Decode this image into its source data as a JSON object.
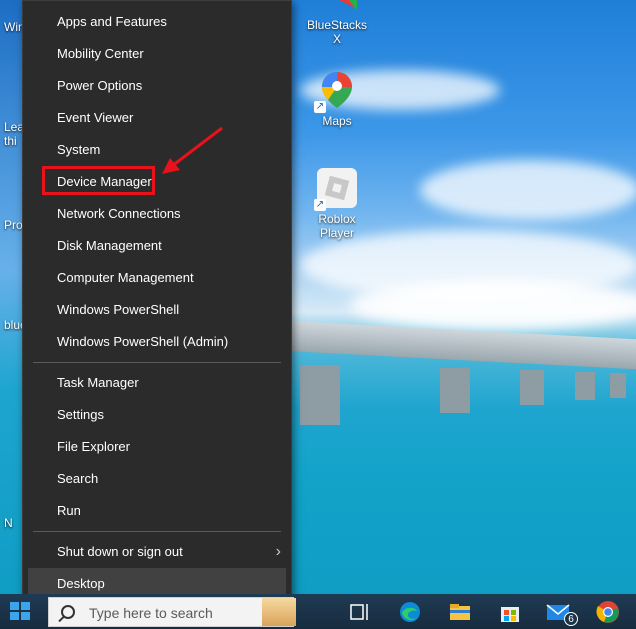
{
  "desktop": {
    "icons": [
      {
        "label": "BlueStacks X"
      },
      {
        "label": "Maps"
      },
      {
        "label": "Roblox Player"
      }
    ],
    "clipped_labels": [
      "Win",
      "Lea",
      "thi",
      "Pro",
      "blue",
      "N"
    ]
  },
  "menu": {
    "items_group1": [
      {
        "label": "Apps and Features"
      },
      {
        "label": "Mobility Center"
      },
      {
        "label": "Power Options"
      },
      {
        "label": "Event Viewer"
      },
      {
        "label": "System"
      },
      {
        "label": "Device Manager"
      },
      {
        "label": "Network Connections"
      },
      {
        "label": "Disk Management"
      },
      {
        "label": "Computer Management"
      },
      {
        "label": "Windows PowerShell"
      },
      {
        "label": "Windows PowerShell (Admin)"
      }
    ],
    "items_group2": [
      {
        "label": "Task Manager"
      },
      {
        "label": "Settings"
      },
      {
        "label": "File Explorer"
      },
      {
        "label": "Search"
      },
      {
        "label": "Run"
      }
    ],
    "items_group3": [
      {
        "label": "Shut down or sign out"
      },
      {
        "label": "Desktop"
      }
    ],
    "highlighted_item": "Device Manager",
    "accent_color": "#e8121a"
  },
  "taskbar": {
    "search_placeholder": "Type here to search",
    "mail_badge": "6"
  }
}
